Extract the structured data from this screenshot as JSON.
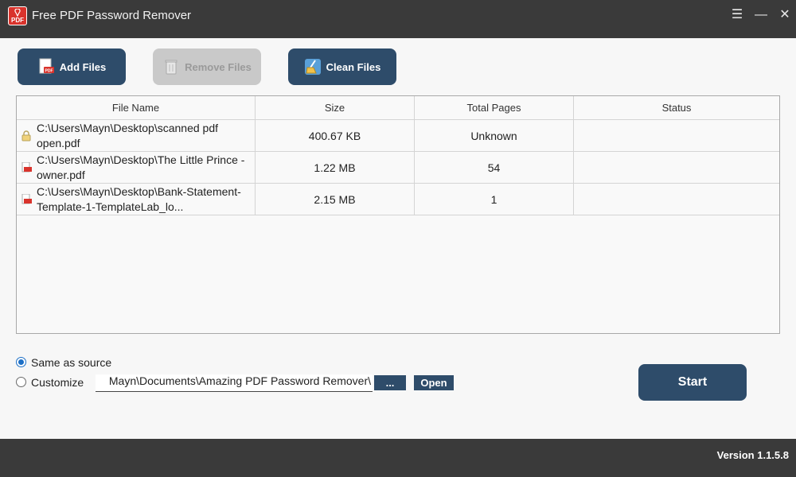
{
  "window": {
    "title": "Free PDF Password Remover",
    "app_icon_text": "PDF",
    "controls": {
      "menu": "☰",
      "minimize": "—",
      "close": "✕"
    }
  },
  "toolbar": {
    "add_files": "Add Files",
    "remove_files": "Remove Files",
    "clean_files": "Clean Files"
  },
  "table": {
    "columns": [
      "File Name",
      "Size",
      "Total Pages",
      "Status"
    ],
    "rows": [
      {
        "icon": "lock-icon",
        "file_name": "C:\\Users\\Mayn\\Desktop\\scanned pdf open.pdf",
        "size": "400.67 KB",
        "total_pages": "Unknown",
        "status": ""
      },
      {
        "icon": "pdf-file-icon",
        "file_name": "C:\\Users\\Mayn\\Desktop\\The Little Prince - owner.pdf",
        "size": "1.22 MB",
        "total_pages": "54",
        "status": ""
      },
      {
        "icon": "pdf-file-icon",
        "file_name": "C:\\Users\\Mayn\\Desktop\\Bank-Statement-Template-1-TemplateLab_lo...",
        "size": "2.15 MB",
        "total_pages": "1",
        "status": ""
      }
    ]
  },
  "output": {
    "same_as_source_label": "Same as source",
    "same_as_source_selected": true,
    "customize_label": "Customize",
    "customize_selected": false,
    "path_value": "Mayn\\Documents\\Amazing PDF Password Remover\\",
    "browse_label": "...",
    "open_label": "Open"
  },
  "start_label": "Start",
  "version": "Version 1.1.5.8",
  "colors": {
    "accent": "#2e4c6a",
    "title_bar": "#3a3a3a",
    "radio_selected": "#1c6fc6",
    "pdf_red": "#d9332c"
  }
}
